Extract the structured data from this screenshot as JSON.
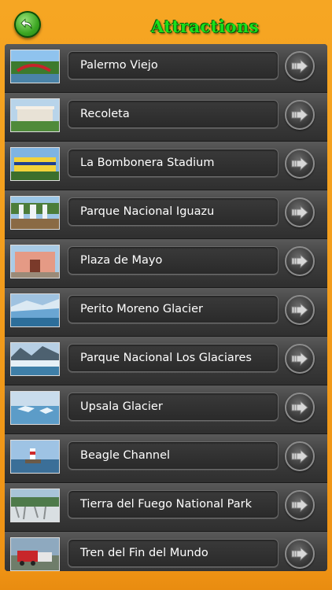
{
  "header": {
    "title": "Attractions",
    "back_icon": "back-arrow-icon"
  },
  "colors": {
    "background": "#f39c1c",
    "title": "#19e01a",
    "row": "#3e3e3e",
    "label_text": "#ffffff"
  },
  "list": {
    "items": [
      {
        "label": "Palermo Viejo"
      },
      {
        "label": "Recoleta"
      },
      {
        "label": "La Bombonera Stadium"
      },
      {
        "label": "Parque Nacional Iguazu"
      },
      {
        "label": "Plaza de Mayo"
      },
      {
        "label": "Perito Moreno Glacier"
      },
      {
        "label": "Parque Nacional Los Glaciares"
      },
      {
        "label": "Upsala Glacier"
      },
      {
        "label": "Beagle Channel"
      },
      {
        "label": "Tierra del Fuego National Park"
      },
      {
        "label": "Tren del Fin del Mundo"
      }
    ]
  }
}
